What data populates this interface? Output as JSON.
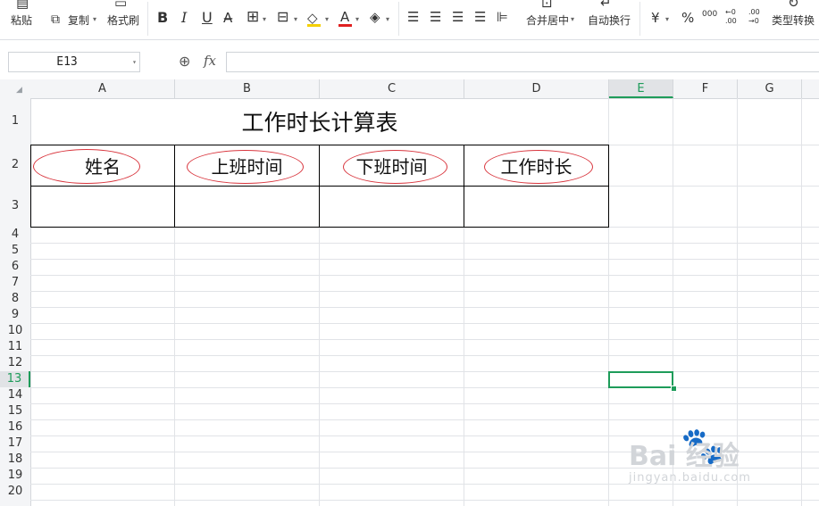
{
  "ribbon": {
    "paste": "粘贴",
    "copy": "复制",
    "format_painter": "格式刷",
    "bold": "B",
    "italic": "I",
    "underline": "U",
    "font_color_glyph": "A",
    "merge_center": "合并居中",
    "wrap_text": "自动换行",
    "currency": "¥",
    "percent": "%",
    "thousands": "000",
    "decimal_increase": "←0 .00",
    "decimal_decrease": ".00 →0",
    "type_convert": "类型转换"
  },
  "formula_bar": {
    "name_box": "E13",
    "fx": "fx",
    "formula_value": ""
  },
  "columns": [
    "A",
    "B",
    "C",
    "D",
    "E",
    "F",
    "G"
  ],
  "active_column": "E",
  "rows": [
    "1",
    "2",
    "3",
    "4",
    "5",
    "6",
    "7",
    "8",
    "9",
    "10",
    "11",
    "12",
    "13",
    "14",
    "15",
    "16",
    "17",
    "18",
    "19",
    "20"
  ],
  "active_row": "13",
  "sheet": {
    "title": "工作时长计算表",
    "headers": [
      "姓名",
      "上班时间",
      "下班时间",
      "工作时长"
    ],
    "row3": [
      "",
      "",
      "",
      ""
    ]
  },
  "selected_cell": "E13",
  "watermark": {
    "brand": "Bai 经验",
    "url": "jingyan.baidu.com"
  },
  "colors": {
    "accent": "#1e9c5a",
    "annotation_oval": "#d9363e",
    "grid": "#e1e3e7"
  }
}
